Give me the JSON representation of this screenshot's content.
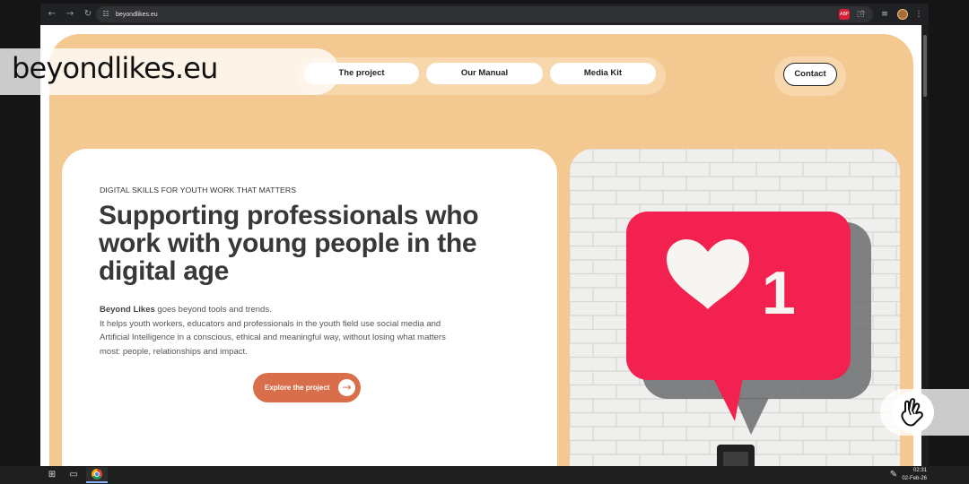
{
  "browser": {
    "url": "beyondlikes.eu",
    "extension_badge": "ABP",
    "colors": {
      "chrome_dark": "#202124",
      "accent_link": "#8ab4f8"
    }
  },
  "overlays": {
    "brand_text": "beyondlikes.eu",
    "hand_icon": "hand-icon"
  },
  "site": {
    "nav": {
      "project": "The project",
      "manual": "Our Manual",
      "media_kit": "Media Kit",
      "contact": "Contact"
    },
    "hero": {
      "eyebrow": "DIGITAL SKILLS FOR YOUTH WORK THAT MATTERS",
      "headline_line1": "Supporting professionals who",
      "headline_line2": "work with young people in the",
      "headline_line3": "digital age",
      "intro_bold": "Beyond Likes",
      "intro_rest": " goes beyond tools and trends.",
      "body_line1": "It helps youth workers, educators and professionals in the youth field use social media and",
      "body_line2": "Artificial Intelligence in a conscious, ethical and meaningful way, without losing what matters",
      "body_line3": "most: people, relationships and impact.",
      "cta": "Explore the project"
    },
    "image": {
      "notification_count": "1"
    },
    "colors": {
      "page_bg": "#f4c891",
      "accent": "#d96e4b",
      "notification_pink": "#f3214f"
    }
  },
  "taskbar": {
    "time": "02:31",
    "date": "02-Feb-26"
  }
}
